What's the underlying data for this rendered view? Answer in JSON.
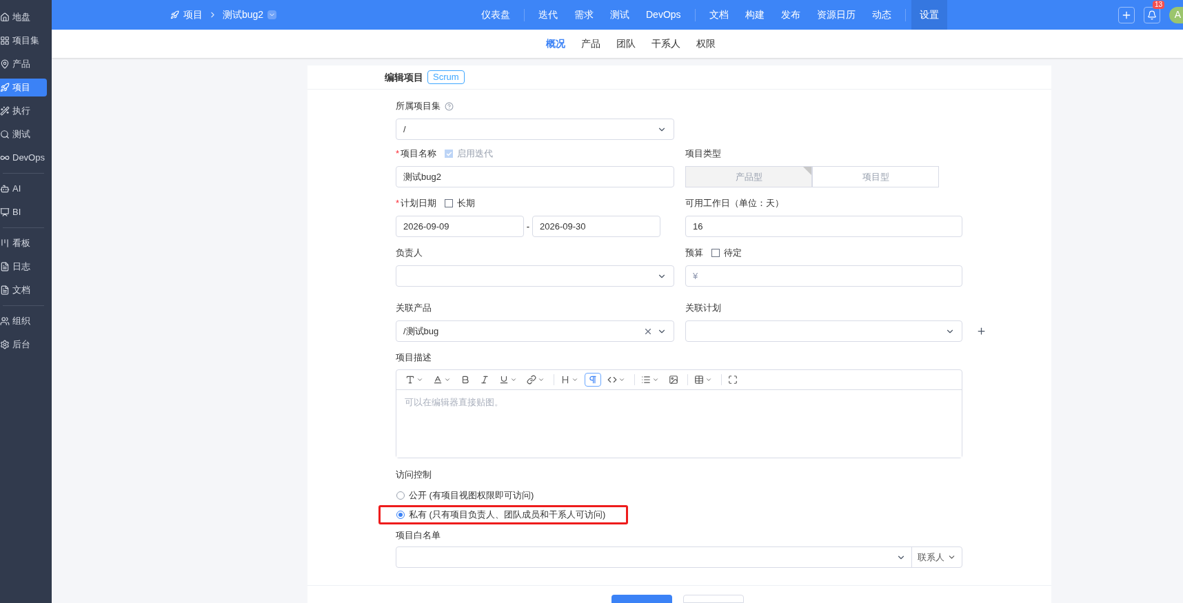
{
  "sidebar": {
    "items": [
      {
        "label": "地盘",
        "selected": false
      },
      {
        "label": "项目集",
        "selected": false
      },
      {
        "label": "产品",
        "selected": false
      },
      {
        "label": "项目",
        "selected": true
      },
      {
        "label": "执行",
        "selected": false
      },
      {
        "label": "测试",
        "selected": false
      },
      {
        "label": "DevOps",
        "selected": false
      },
      {
        "label": "AI",
        "selected": false
      },
      {
        "label": "BI",
        "selected": false
      },
      {
        "label": "看板",
        "selected": false
      },
      {
        "label": "日志",
        "selected": false
      },
      {
        "label": "文档",
        "selected": false
      },
      {
        "label": "组织",
        "selected": false
      },
      {
        "label": "后台",
        "selected": false
      }
    ]
  },
  "topbar": {
    "breadcrumb": [
      "项目",
      "测试bug2"
    ],
    "nav": [
      {
        "label": "仪表盘",
        "selected": false
      },
      {
        "label": "迭代",
        "selected": false
      },
      {
        "label": "需求",
        "selected": false
      },
      {
        "label": "测试",
        "selected": false
      },
      {
        "label": "DevOps",
        "selected": false
      },
      {
        "label": "文档",
        "selected": false
      },
      {
        "label": "构建",
        "selected": false
      },
      {
        "label": "发布",
        "selected": false
      },
      {
        "label": "资源日历",
        "selected": false
      },
      {
        "label": "动态",
        "selected": false
      },
      {
        "label": "设置",
        "selected": true
      }
    ],
    "notification_count": "13",
    "avatar": "A"
  },
  "subnav": [
    {
      "label": "概况",
      "selected": true
    },
    {
      "label": "产品",
      "selected": false
    },
    {
      "label": "团队",
      "selected": false
    },
    {
      "label": "干系人",
      "selected": false
    },
    {
      "label": "权限",
      "selected": false
    }
  ],
  "form": {
    "title": "编辑项目",
    "badge": "Scrum",
    "program": {
      "label": "所属项目集",
      "value": "/"
    },
    "name": {
      "label": "项目名称",
      "required_mark": "*",
      "value": "测试bug2",
      "iteration": {
        "label": "启用迭代",
        "checked": true,
        "disabled": true
      }
    },
    "type": {
      "label": "项目类型",
      "disabled": true,
      "options": [
        {
          "label": "产品型",
          "selected": true
        },
        {
          "label": "项目型",
          "selected": false
        }
      ]
    },
    "dates": {
      "label": "计划日期",
      "required_mark": "*",
      "long_term": {
        "label": "长期",
        "checked": false
      },
      "begin": "2026-09-09",
      "separator": "-",
      "end": "2026-09-30"
    },
    "workdays": {
      "label": "可用工作日（单位：天）",
      "value": "16"
    },
    "owner": {
      "label": "负责人"
    },
    "budget": {
      "label": "预算",
      "pending": {
        "label": "待定",
        "checked": false
      },
      "placeholder": "¥"
    },
    "products": {
      "label": "关联产品",
      "value": "/测试bug"
    },
    "plans": {
      "label": "关联计划"
    },
    "description": {
      "label": "项目描述",
      "placeholder": "可以在编辑器直接贴图。",
      "toolbar": [
        {
          "kind": "font-size",
          "dropdown": true,
          "selected": false
        },
        {
          "kind": "font-color",
          "dropdown": true,
          "selected": false
        },
        {
          "kind": "bold",
          "dropdown": false,
          "selected": false
        },
        {
          "kind": "italic",
          "dropdown": false,
          "selected": false
        },
        {
          "kind": "underline",
          "dropdown": true,
          "selected": false
        },
        {
          "kind": "link",
          "dropdown": true,
          "selected": false
        },
        {
          "kind": "heading",
          "dropdown": true,
          "selected": false
        },
        {
          "kind": "paragraph",
          "dropdown": false,
          "selected": true
        },
        {
          "kind": "code",
          "dropdown": true,
          "selected": false
        },
        {
          "kind": "list",
          "dropdown": true,
          "selected": false
        },
        {
          "kind": "image",
          "dropdown": false,
          "selected": false
        },
        {
          "kind": "table",
          "dropdown": true,
          "selected": false
        },
        {
          "kind": "fullscreen",
          "dropdown": false,
          "selected": false
        }
      ]
    },
    "access": {
      "label": "访问控制",
      "options": [
        {
          "label": "公开 (有项目视图权限即可访问)",
          "selected": false,
          "highlighted": false
        },
        {
          "label": "私有 (只有项目负责人、团队成员和干系人可访问)",
          "selected": true,
          "highlighted": true
        }
      ]
    },
    "whitelist": {
      "label": "项目白名单",
      "addon": "联系人"
    }
  }
}
